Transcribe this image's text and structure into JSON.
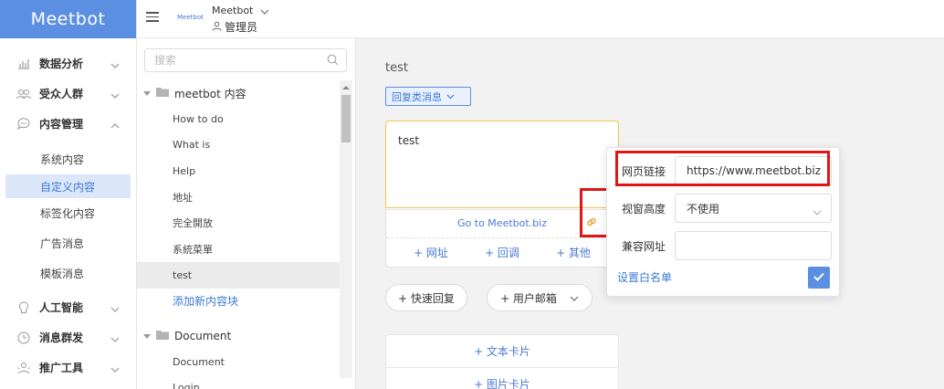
{
  "app": {
    "logo": "Meetbot",
    "brand_mini": "Meetbot"
  },
  "header": {
    "account_name": "Meetbot",
    "role": "管理员"
  },
  "sidebar": {
    "groups": [
      {
        "label": "数据分析",
        "icon": "bar-chart-icon"
      },
      {
        "label": "受众人群",
        "icon": "users-icon"
      },
      {
        "label": "内容管理",
        "icon": "chat-bubble-icon",
        "expanded": true,
        "items": [
          "系统内容",
          "自定义内容",
          "标签化内容",
          "广告消息",
          "模板消息"
        ],
        "active": "自定义内容"
      },
      {
        "label": "人工智能",
        "icon": "ai-brain-icon"
      },
      {
        "label": "消息群发",
        "icon": "clock-icon"
      },
      {
        "label": "推广工具",
        "icon": "promo-icon"
      }
    ]
  },
  "tree": {
    "search_placeholder": "搜索",
    "folder1": "meetbot 内容",
    "items1": [
      "How to do",
      "What is",
      "Help",
      "地址",
      "完全開放",
      "系統菜單",
      "test"
    ],
    "selected": "test",
    "add_label": "添加新内容块",
    "folder2": "Document",
    "items2": [
      "Document",
      "Login"
    ]
  },
  "main": {
    "title": "test",
    "reply_type": "回复类消息",
    "editor_text": "test",
    "link_button": "Go to Meetbot.biz",
    "actions": [
      "+ 网址",
      "+ 回调",
      "+ 其他"
    ],
    "quick_reply": "+ 快速回复",
    "user_email": "+ 用户邮箱",
    "add_text_card": "+ 文本卡片",
    "add_image_card": "+ 图片卡片"
  },
  "popover": {
    "url_label": "网页链接",
    "url_value": "https://www.meetbot.biz",
    "height_label": "视窗高度",
    "height_value": "不使用",
    "fallback_label": "兼容网址",
    "fallback_value": "",
    "whitelist": "设置白名单"
  },
  "colors": {
    "accent": "#5b8fe1",
    "highlight": "#e01515",
    "editor_border": "#f2c84b"
  }
}
